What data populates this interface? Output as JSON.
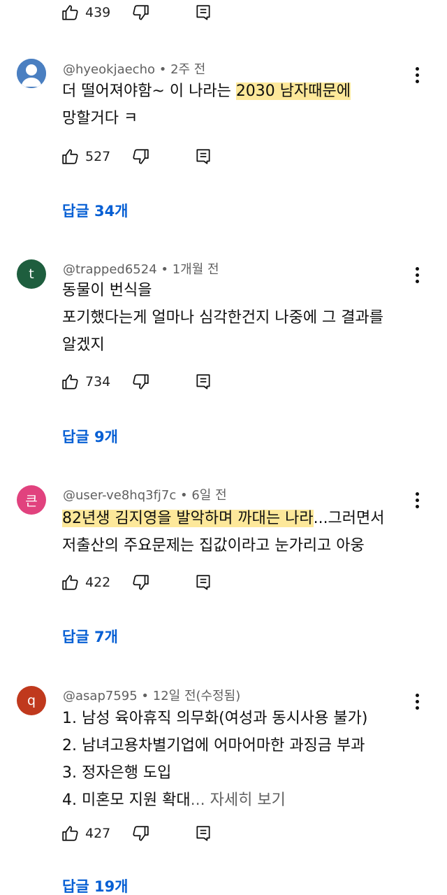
{
  "top_actions": {
    "like_count": "439"
  },
  "comments": [
    {
      "avatar_letter": "",
      "avatar_color": "#4a7fc1",
      "username": "@hyeokjaecho",
      "time": "2주 전",
      "lines": [
        {
          "pre": "더 떨어져야함~ 이 나라는 ",
          "hl": "2030 남자때문에",
          "post": ""
        },
        {
          "pre": "망할거다 ㅋ",
          "hl": "",
          "post": ""
        }
      ],
      "like_count": "527",
      "replies": "답글 34개"
    },
    {
      "avatar_letter": "t",
      "avatar_color": "#1e5e3e",
      "username": "@trapped6524",
      "time": "1개월 전",
      "lines": [
        {
          "pre": "동물이 번식을",
          "hl": "",
          "post": ""
        },
        {
          "pre": "포기했다는게 얼마나 심각한건지 나중에 그 결과를",
          "hl": "",
          "post": ""
        },
        {
          "pre": "알겠지",
          "hl": "",
          "post": ""
        }
      ],
      "like_count": "734",
      "replies": "답글 9개"
    },
    {
      "avatar_letter": "큰",
      "avatar_color": "#e1427e",
      "username": "@user-ve8hq3fj7c",
      "time": "6일 전",
      "lines": [
        {
          "pre": "",
          "hl": "82년생 김지영을 발악하며 까대는 나라",
          "post": "...그러면서"
        },
        {
          "pre": "저출산의 주요문제는 집값이라고 눈가리고 아웅",
          "hl": "",
          "post": ""
        }
      ],
      "like_count": "422",
      "replies": "답글 7개"
    },
    {
      "avatar_letter": "q",
      "avatar_color": "#c0391d",
      "username": "@asap7595",
      "time": "12일 전(수정됨)",
      "lines": [
        {
          "pre": "1. 남성 육아휴직 의무화(여성과 동시사용 불가)",
          "hl": "",
          "post": ""
        },
        {
          "pre": "2. 남녀고용차별기업에 어마어마한 과징금 부과",
          "hl": "",
          "post": ""
        },
        {
          "pre": "3. 정자은행 도입",
          "hl": "",
          "post": ""
        },
        {
          "pre": "4. 미혼모 지원 확대",
          "hl": "",
          "post": ""
        }
      ],
      "more_label": "... 자세히 보기",
      "like_count": "427",
      "replies": "답글 19개"
    }
  ]
}
